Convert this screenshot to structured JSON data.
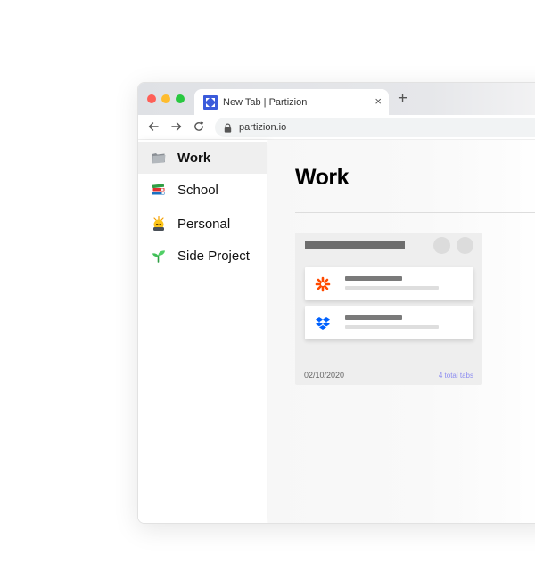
{
  "browser": {
    "tab_title": "New Tab | Partizion",
    "close_glyph": "×",
    "new_tab_glyph": "+",
    "url": "partizion.io",
    "traffic_lights": {
      "close": "#fe5f57",
      "minimize": "#febc2e",
      "zoom": "#28c840"
    }
  },
  "sidebar": {
    "items": [
      {
        "label": "Work",
        "icon": "folder-icon",
        "active": true
      },
      {
        "label": "School",
        "icon": "books-icon",
        "active": false
      },
      {
        "label": "Personal",
        "icon": "person-emoji-icon",
        "active": false
      },
      {
        "label": "Side Project",
        "icon": "seedling-icon",
        "active": false
      }
    ]
  },
  "main": {
    "title": "Work",
    "group": {
      "date": "02/10/2020",
      "tab_count": "4 total tabs",
      "tabs": [
        {
          "icon": "zapier-icon"
        },
        {
          "icon": "dropbox-icon"
        }
      ]
    }
  },
  "colors": {
    "brand_blue": "#3b5bdb",
    "zapier_orange": "#ff4a00",
    "dropbox_blue": "#0061fe",
    "count_accent": "#8c8cf0"
  }
}
